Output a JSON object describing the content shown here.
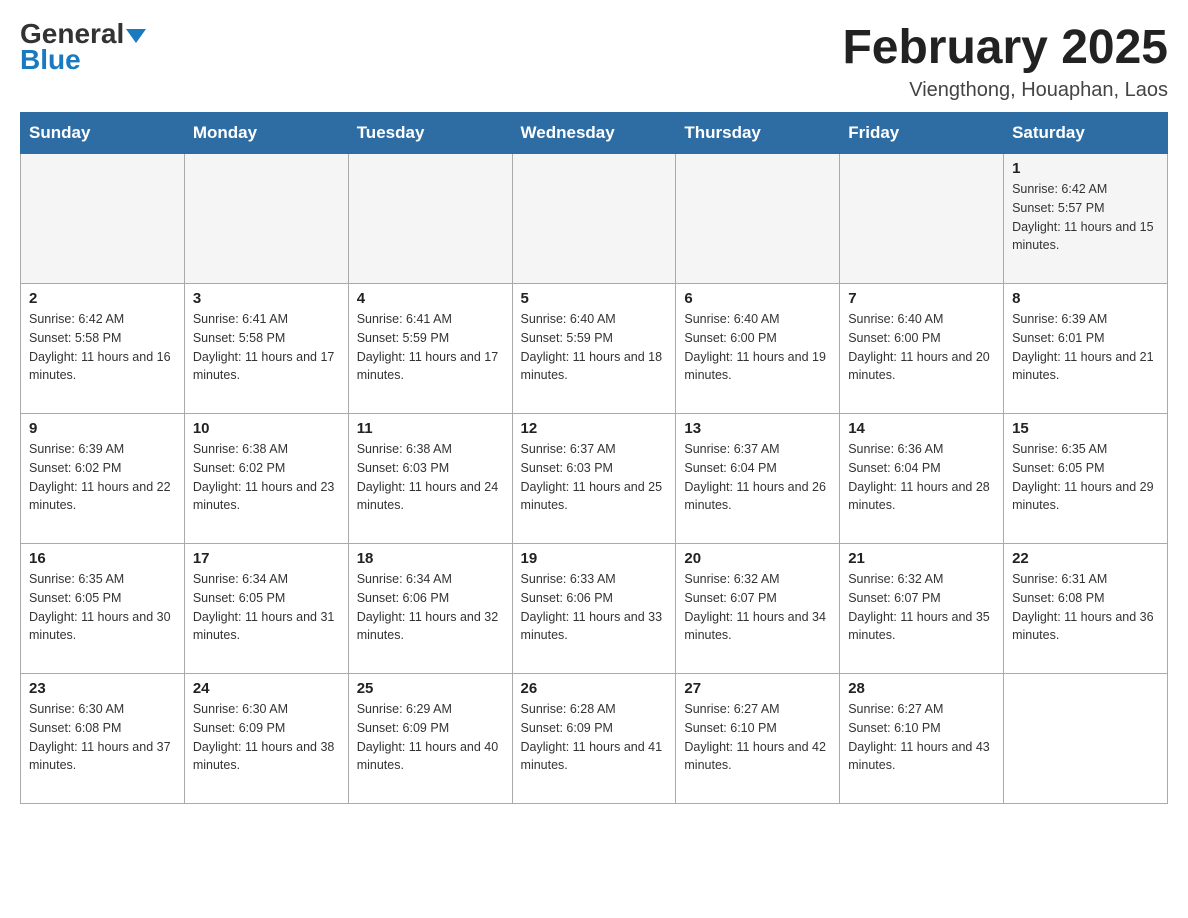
{
  "logo": {
    "part1": "General",
    "part2": "Blue"
  },
  "title": "February 2025",
  "subtitle": "Viengthong, Houaphan, Laos",
  "days_of_week": [
    "Sunday",
    "Monday",
    "Tuesday",
    "Wednesday",
    "Thursday",
    "Friday",
    "Saturday"
  ],
  "weeks": [
    [
      {
        "day": "",
        "info": ""
      },
      {
        "day": "",
        "info": ""
      },
      {
        "day": "",
        "info": ""
      },
      {
        "day": "",
        "info": ""
      },
      {
        "day": "",
        "info": ""
      },
      {
        "day": "",
        "info": ""
      },
      {
        "day": "1",
        "info": "Sunrise: 6:42 AM\nSunset: 5:57 PM\nDaylight: 11 hours and 15 minutes."
      }
    ],
    [
      {
        "day": "2",
        "info": "Sunrise: 6:42 AM\nSunset: 5:58 PM\nDaylight: 11 hours and 16 minutes."
      },
      {
        "day": "3",
        "info": "Sunrise: 6:41 AM\nSunset: 5:58 PM\nDaylight: 11 hours and 17 minutes."
      },
      {
        "day": "4",
        "info": "Sunrise: 6:41 AM\nSunset: 5:59 PM\nDaylight: 11 hours and 17 minutes."
      },
      {
        "day": "5",
        "info": "Sunrise: 6:40 AM\nSunset: 5:59 PM\nDaylight: 11 hours and 18 minutes."
      },
      {
        "day": "6",
        "info": "Sunrise: 6:40 AM\nSunset: 6:00 PM\nDaylight: 11 hours and 19 minutes."
      },
      {
        "day": "7",
        "info": "Sunrise: 6:40 AM\nSunset: 6:00 PM\nDaylight: 11 hours and 20 minutes."
      },
      {
        "day": "8",
        "info": "Sunrise: 6:39 AM\nSunset: 6:01 PM\nDaylight: 11 hours and 21 minutes."
      }
    ],
    [
      {
        "day": "9",
        "info": "Sunrise: 6:39 AM\nSunset: 6:02 PM\nDaylight: 11 hours and 22 minutes."
      },
      {
        "day": "10",
        "info": "Sunrise: 6:38 AM\nSunset: 6:02 PM\nDaylight: 11 hours and 23 minutes."
      },
      {
        "day": "11",
        "info": "Sunrise: 6:38 AM\nSunset: 6:03 PM\nDaylight: 11 hours and 24 minutes."
      },
      {
        "day": "12",
        "info": "Sunrise: 6:37 AM\nSunset: 6:03 PM\nDaylight: 11 hours and 25 minutes."
      },
      {
        "day": "13",
        "info": "Sunrise: 6:37 AM\nSunset: 6:04 PM\nDaylight: 11 hours and 26 minutes."
      },
      {
        "day": "14",
        "info": "Sunrise: 6:36 AM\nSunset: 6:04 PM\nDaylight: 11 hours and 28 minutes."
      },
      {
        "day": "15",
        "info": "Sunrise: 6:35 AM\nSunset: 6:05 PM\nDaylight: 11 hours and 29 minutes."
      }
    ],
    [
      {
        "day": "16",
        "info": "Sunrise: 6:35 AM\nSunset: 6:05 PM\nDaylight: 11 hours and 30 minutes."
      },
      {
        "day": "17",
        "info": "Sunrise: 6:34 AM\nSunset: 6:05 PM\nDaylight: 11 hours and 31 minutes."
      },
      {
        "day": "18",
        "info": "Sunrise: 6:34 AM\nSunset: 6:06 PM\nDaylight: 11 hours and 32 minutes."
      },
      {
        "day": "19",
        "info": "Sunrise: 6:33 AM\nSunset: 6:06 PM\nDaylight: 11 hours and 33 minutes."
      },
      {
        "day": "20",
        "info": "Sunrise: 6:32 AM\nSunset: 6:07 PM\nDaylight: 11 hours and 34 minutes."
      },
      {
        "day": "21",
        "info": "Sunrise: 6:32 AM\nSunset: 6:07 PM\nDaylight: 11 hours and 35 minutes."
      },
      {
        "day": "22",
        "info": "Sunrise: 6:31 AM\nSunset: 6:08 PM\nDaylight: 11 hours and 36 minutes."
      }
    ],
    [
      {
        "day": "23",
        "info": "Sunrise: 6:30 AM\nSunset: 6:08 PM\nDaylight: 11 hours and 37 minutes."
      },
      {
        "day": "24",
        "info": "Sunrise: 6:30 AM\nSunset: 6:09 PM\nDaylight: 11 hours and 38 minutes."
      },
      {
        "day": "25",
        "info": "Sunrise: 6:29 AM\nSunset: 6:09 PM\nDaylight: 11 hours and 40 minutes."
      },
      {
        "day": "26",
        "info": "Sunrise: 6:28 AM\nSunset: 6:09 PM\nDaylight: 11 hours and 41 minutes."
      },
      {
        "day": "27",
        "info": "Sunrise: 6:27 AM\nSunset: 6:10 PM\nDaylight: 11 hours and 42 minutes."
      },
      {
        "day": "28",
        "info": "Sunrise: 6:27 AM\nSunset: 6:10 PM\nDaylight: 11 hours and 43 minutes."
      },
      {
        "day": "",
        "info": ""
      }
    ]
  ]
}
